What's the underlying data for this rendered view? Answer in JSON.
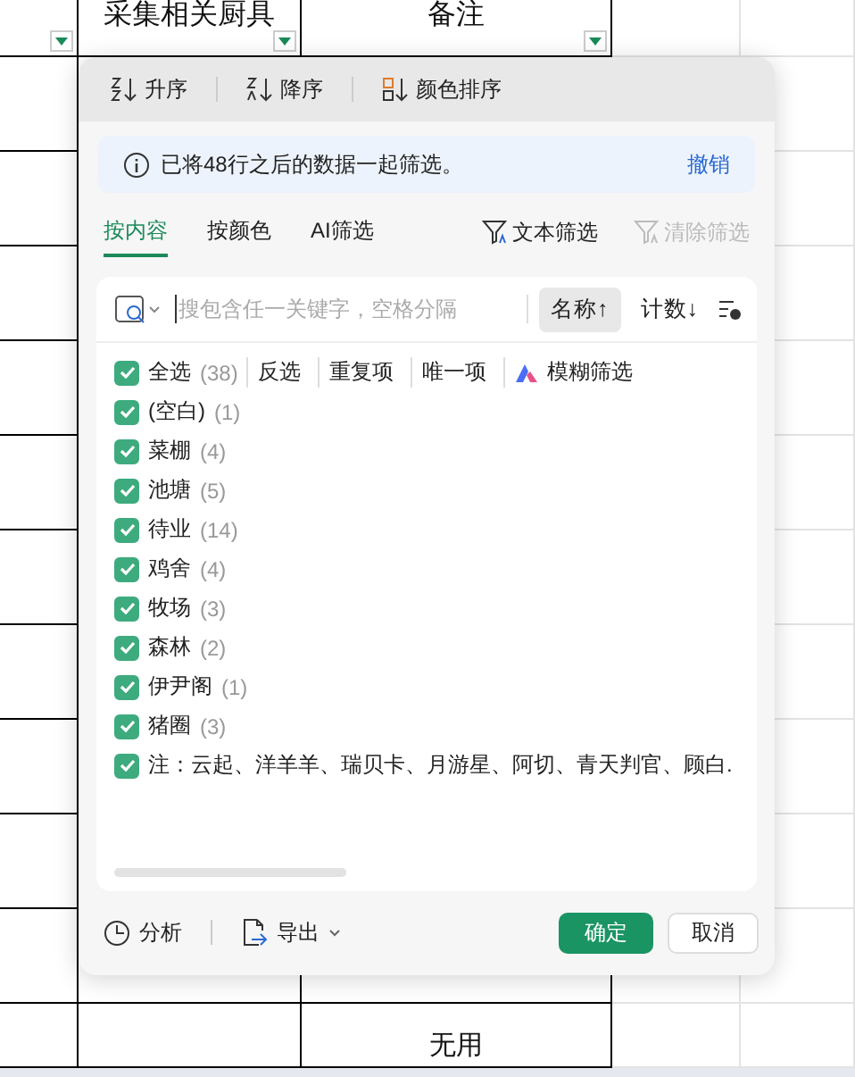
{
  "sheet": {
    "header": [
      "采集相关厨具",
      "备注"
    ],
    "bottom_cell": "无用"
  },
  "filter_panel": {
    "sort_buttons": [
      {
        "label": "升序",
        "kind": "asc"
      },
      {
        "label": "降序",
        "kind": "desc"
      },
      {
        "label": "颜色排序",
        "kind": "color"
      }
    ],
    "notice": {
      "text": "已将48行之后的数据一起筛选。",
      "action": "撤销"
    },
    "tabs": [
      {
        "label": "按内容",
        "selected": true
      },
      {
        "label": "按颜色",
        "selected": false
      },
      {
        "label": "AI筛选",
        "selected": false
      }
    ],
    "tools": [
      {
        "label": "文本筛选",
        "disabled": false
      },
      {
        "label": "清除筛选",
        "disabled": true
      }
    ],
    "search": {
      "placeholder": "搜包含任一关键字，空格分隔"
    },
    "order_buttons": [
      {
        "label": "名称↑",
        "selected": true
      },
      {
        "label": "计数↓",
        "selected": false
      }
    ],
    "select_all": {
      "label": "全选",
      "count": "(38)",
      "checked": true
    },
    "quick_actions": [
      "反选",
      "重复项",
      "唯一项"
    ],
    "fuzzy": "模糊筛选",
    "items": [
      {
        "label": "(空白)",
        "count": "(1)",
        "checked": true
      },
      {
        "label": "菜棚",
        "count": "(4)",
        "checked": true
      },
      {
        "label": "池塘",
        "count": "(5)",
        "checked": true
      },
      {
        "label": "待业",
        "count": "(14)",
        "checked": true
      },
      {
        "label": "鸡舍",
        "count": "(4)",
        "checked": true
      },
      {
        "label": "牧场",
        "count": "(3)",
        "checked": true
      },
      {
        "label": "森林",
        "count": "(2)",
        "checked": true
      },
      {
        "label": "伊尹阁",
        "count": "(1)",
        "checked": true
      },
      {
        "label": "猪圈",
        "count": "(3)",
        "checked": true
      },
      {
        "label": "注：云起、洋羊羊、瑞贝卡、月游星、阿切、青天判官、顾白.",
        "checked": true
      }
    ],
    "footer": {
      "left": [
        {
          "label": "分析",
          "kind": "analyze"
        },
        {
          "label": "导出",
          "kind": "export"
        }
      ],
      "confirm": "确定",
      "cancel": "取消"
    }
  }
}
